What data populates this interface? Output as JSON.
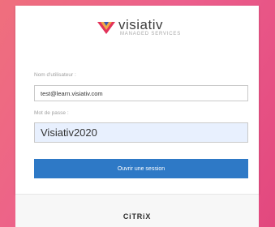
{
  "brand": {
    "name": "visiativ",
    "tagline": "MANAGED SERVICES"
  },
  "form": {
    "username_label": "Nom d'utilisateur :",
    "username_value": "test@learn.visiativ.com",
    "password_label": "Mot de passe :",
    "password_value": "Visiativ2020",
    "submit_label": "Ouvrir une session"
  },
  "footer": {
    "vendor": "CiTRiX"
  },
  "colors": {
    "accent": "#2e79c6",
    "autofill": "#e8f0fe"
  }
}
